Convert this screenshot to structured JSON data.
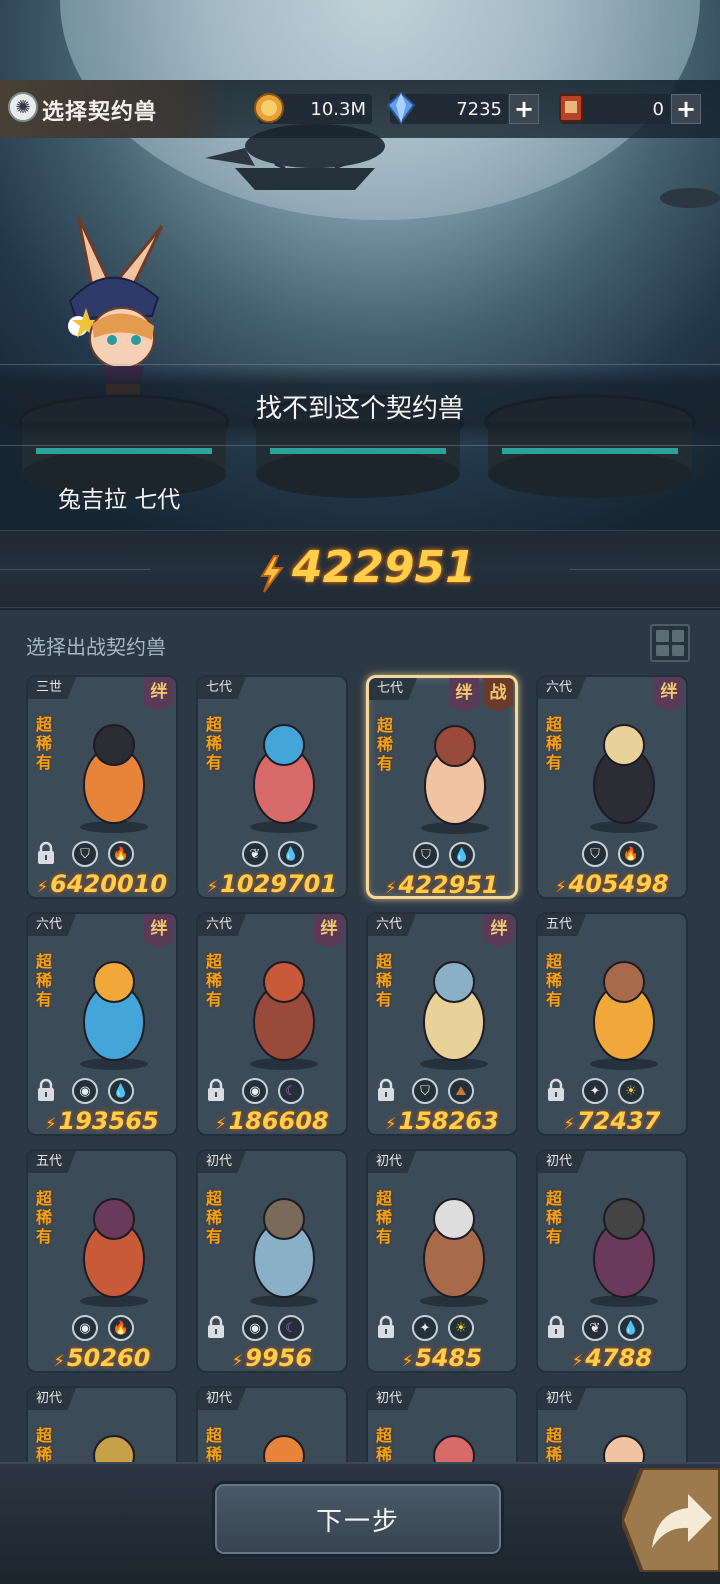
{
  "header": {
    "title": "选择契约兽",
    "resources": [
      {
        "name": "gold-coin-icon",
        "value": "10.3M"
      },
      {
        "name": "blue-crystal-icon",
        "value": "7235"
      },
      {
        "name": "summon-ticket-icon",
        "value": "0"
      }
    ]
  },
  "preview": {
    "notice": "找不到这个契约兽",
    "beast_name": "兔吉拉 七代",
    "total_power": "422951"
  },
  "list": {
    "title": "选择出战契约兽",
    "rarity_label": "超稀有",
    "cards": [
      {
        "gen": "三世",
        "power": "6420010",
        "bond": "绊",
        "locked": true,
        "icons": [
          "shield-icon",
          "fire-icon"
        ]
      },
      {
        "gen": "七代",
        "power": "1029701",
        "bond": "",
        "locked": false,
        "icons": [
          "leaf-icon",
          "water-drop-icon"
        ]
      },
      {
        "gen": "七代",
        "power": "422951",
        "bond": "绊",
        "battle": "战",
        "selected": true,
        "locked": false,
        "icons": [
          "shield-icon",
          "water-drop-icon"
        ]
      },
      {
        "gen": "六代",
        "power": "405498",
        "bond": "绊",
        "locked": false,
        "icons": [
          "shield-icon",
          "fire-icon"
        ]
      },
      {
        "gen": "六代",
        "power": "193565",
        "bond": "绊",
        "locked": true,
        "icons": [
          "eye-icon",
          "water-drop-icon"
        ]
      },
      {
        "gen": "六代",
        "power": "186608",
        "bond": "绊",
        "locked": true,
        "icons": [
          "eye-icon",
          "moon-icon"
        ]
      },
      {
        "gen": "六代",
        "power": "158263",
        "bond": "绊",
        "locked": true,
        "icons": [
          "shield-icon",
          "earth-icon"
        ]
      },
      {
        "gen": "五代",
        "power": "72437",
        "bond": "",
        "locked": true,
        "icons": [
          "star-cross-icon",
          "sun-icon"
        ]
      },
      {
        "gen": "五代",
        "power": "50260",
        "bond": "",
        "locked": false,
        "icons": [
          "eye-icon",
          "fire-icon"
        ]
      },
      {
        "gen": "初代",
        "power": "9956",
        "bond": "",
        "locked": true,
        "icons": [
          "eye-icon",
          "moon-icon"
        ]
      },
      {
        "gen": "初代",
        "power": "5485",
        "bond": "",
        "locked": true,
        "icons": [
          "star-cross-icon",
          "sun-icon"
        ]
      },
      {
        "gen": "初代",
        "power": "4788",
        "bond": "",
        "locked": true,
        "icons": [
          "leaf-icon",
          "water-drop-icon"
        ]
      },
      {
        "gen": "初代",
        "power": "",
        "bond": "",
        "locked": false,
        "icons": []
      },
      {
        "gen": "初代",
        "power": "",
        "bond": "",
        "locked": false,
        "icons": []
      },
      {
        "gen": "初代",
        "power": "",
        "bond": "",
        "locked": false,
        "icons": []
      },
      {
        "gen": "初代",
        "power": "",
        "bond": "",
        "locked": false,
        "icons": []
      }
    ]
  },
  "footer": {
    "next_label": "下一步"
  },
  "colors": {
    "power_gold": "#ffcf4a",
    "rarity_orange": "#f2a31b",
    "selected_border": "#f4d99a",
    "panel_bg": "#2c3945"
  }
}
